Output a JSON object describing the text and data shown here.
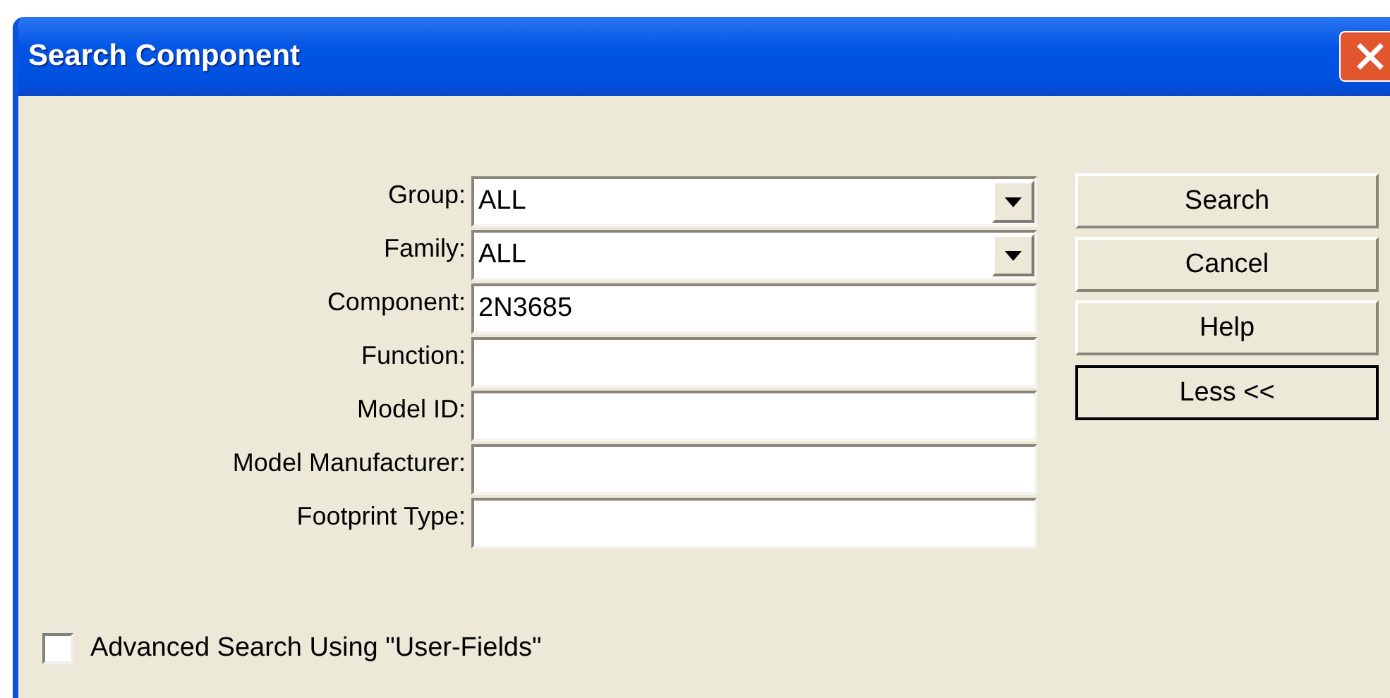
{
  "window": {
    "title": "Search Component"
  },
  "fields": [
    {
      "label": "Group:",
      "kind": "combo",
      "value": "ALL"
    },
    {
      "label": "Family:",
      "kind": "combo",
      "value": "ALL"
    },
    {
      "label": "Component:",
      "kind": "text",
      "value": "2N3685"
    },
    {
      "label": "Function:",
      "kind": "text"
    },
    {
      "label": "Model ID:",
      "kind": "text"
    },
    {
      "label": "Model Manufacturer:",
      "kind": "text"
    },
    {
      "label": "Footprint Type:",
      "kind": "text"
    }
  ],
  "buttons": [
    {
      "label": "Search",
      "default": false
    },
    {
      "label": "Cancel",
      "default": false
    },
    {
      "label": "Help",
      "default": false
    },
    {
      "label": "Less <<",
      "default": true
    }
  ],
  "advanced_search": {
    "label": "Advanced Search Using \"User-Fields\"",
    "checked": false
  }
}
